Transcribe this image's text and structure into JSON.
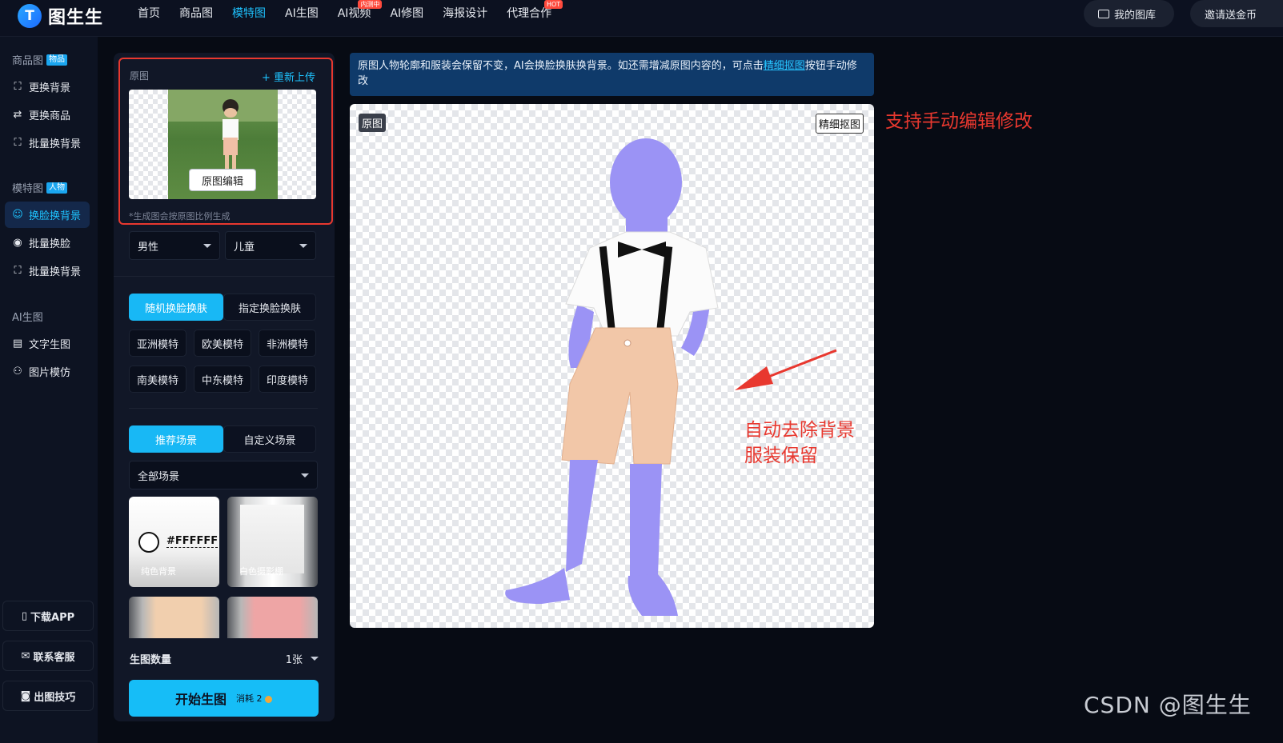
{
  "brand": {
    "name": "图生生",
    "mark": "T"
  },
  "nav": [
    {
      "label": "首页",
      "badge": ""
    },
    {
      "label": "商品图",
      "badge": ""
    },
    {
      "label": "模特图",
      "badge": "",
      "active": true
    },
    {
      "label": "AI生图",
      "badge": ""
    },
    {
      "label": "AI视频",
      "badge": "内测中"
    },
    {
      "label": "AI修图",
      "badge": ""
    },
    {
      "label": "海报设计",
      "badge": ""
    },
    {
      "label": "代理合作",
      "badge": "HOT"
    }
  ],
  "top_actions": {
    "library": "我的图库",
    "invite": "邀请送金币"
  },
  "sidebar": {
    "group_product": {
      "title": "商品图",
      "tag": "物品"
    },
    "product_items": [
      "更换背景",
      "更换商品",
      "批量换背景"
    ],
    "group_model": {
      "title": "模特图",
      "tag": "人物"
    },
    "model_items": [
      "换脸换背景",
      "批量换脸",
      "批量换背景"
    ],
    "group_ai": {
      "title": "AI生图"
    },
    "ai_items": [
      "文字生图",
      "图片模仿"
    ],
    "bottom": [
      "下载APP",
      "联系客服",
      "出图技巧"
    ]
  },
  "panel": {
    "orig_label": "原图",
    "reupload": "+ 重新上传",
    "edit_btn": "原图编辑",
    "ratio_note": "*生成图会按原图比例生成",
    "gender": "男性",
    "age": "儿童",
    "face_tabs": [
      "随机换脸换肤",
      "指定换脸换肤"
    ],
    "model_chips": [
      "亚洲模特",
      "欧美模特",
      "非洲模特",
      "南美模特",
      "中东模特",
      "印度模特"
    ],
    "scene_tabs": [
      "推荐场景",
      "自定义场景"
    ],
    "scene_select": "全部场景",
    "scenes": [
      {
        "caption": "纯色背景",
        "value": "#FFFFFF"
      },
      {
        "caption": "白色摄影棚"
      }
    ],
    "count_label": "生图数量",
    "count_value": "1张",
    "start_btn": "开始生图",
    "cost": "消耗 2"
  },
  "info": {
    "text_before": "原图人物轮廓和服装会保留不变，AI会换脸换肤换背景。如还需增减原图内容的，可点击",
    "link": "精细抠图",
    "text_after": "按钮手动修改"
  },
  "canvas": {
    "tag_orig": "原图",
    "tag_fine": "精细抠图"
  },
  "annotations": {
    "manual_edit": "支持手动编辑修改",
    "auto_line1": "自动去除背景",
    "auto_line2": "服装保留"
  },
  "watermark": "CSDN @图生生",
  "colors": {
    "accent": "#18b8f5",
    "highlight": "#e8382f",
    "silhouette": "#9b93f5",
    "shorts": "#f2c7a8"
  }
}
